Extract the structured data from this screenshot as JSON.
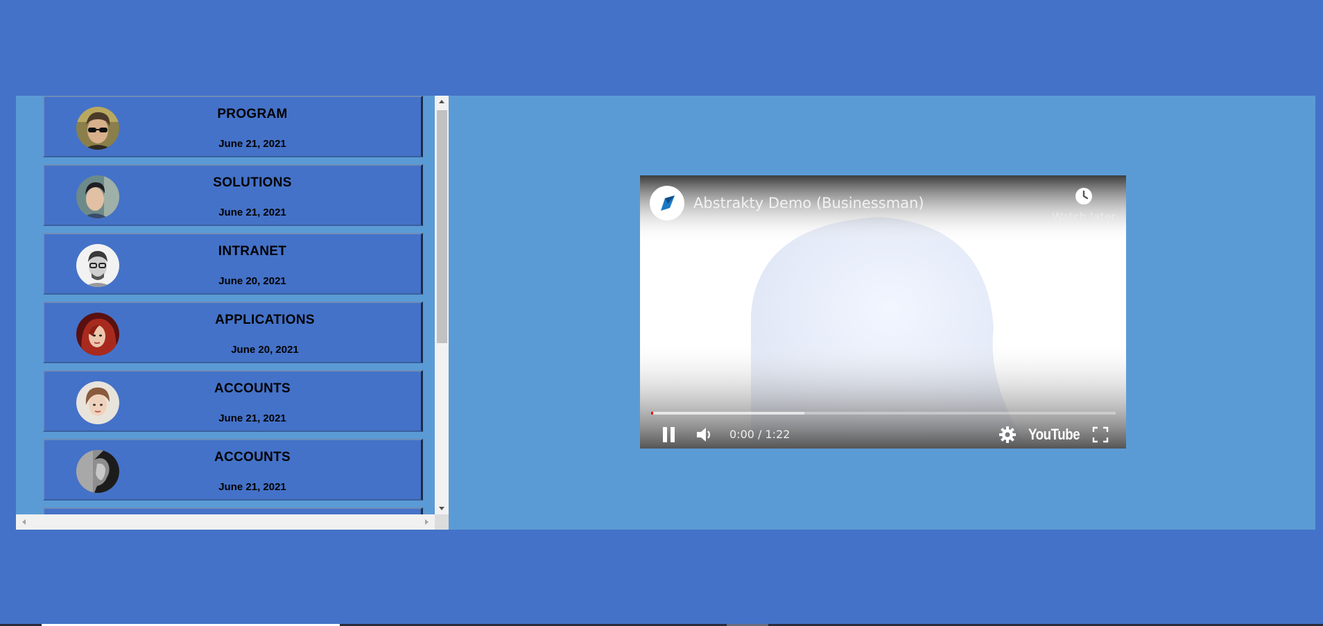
{
  "list": {
    "items": [
      {
        "title": "PROGRAM",
        "date": "June 21, 2021",
        "avatar": "avatar-man-sunglasses"
      },
      {
        "title": "SOLUTIONS",
        "date": "June 21, 2021",
        "avatar": "avatar-man-outdoor"
      },
      {
        "title": "INTRANET",
        "date": "June 20, 2021",
        "avatar": "avatar-man-glasses"
      },
      {
        "title": "APPLICATIONS",
        "date": "June 20, 2021",
        "avatar": "avatar-woman-red-hair"
      },
      {
        "title": "ACCOUNTS",
        "date": "June 21, 2021",
        "avatar": "avatar-woman-light"
      },
      {
        "title": "ACCOUNTS",
        "date": "June 21, 2021",
        "avatar": "avatar-man-profile"
      }
    ]
  },
  "video": {
    "title": "Abstrakty Demo (Businessman)",
    "watch_later_label": "Watch later",
    "time": "0:00 / 1:22",
    "brand": "YouTube",
    "progress": 0.0,
    "buffered_fraction": 0.33
  },
  "colors": {
    "page_bg": "#4472c8",
    "panel_bg": "#5b9bd5",
    "card_bg": "#4472c8",
    "progress_red": "#ff0000"
  },
  "icons": {
    "play_state": "pause-icon",
    "volume": "volume-icon",
    "settings": "gear-icon",
    "fullscreen": "fullscreen-icon",
    "watch_later": "clock-icon",
    "channel": "channel-logo-icon"
  }
}
